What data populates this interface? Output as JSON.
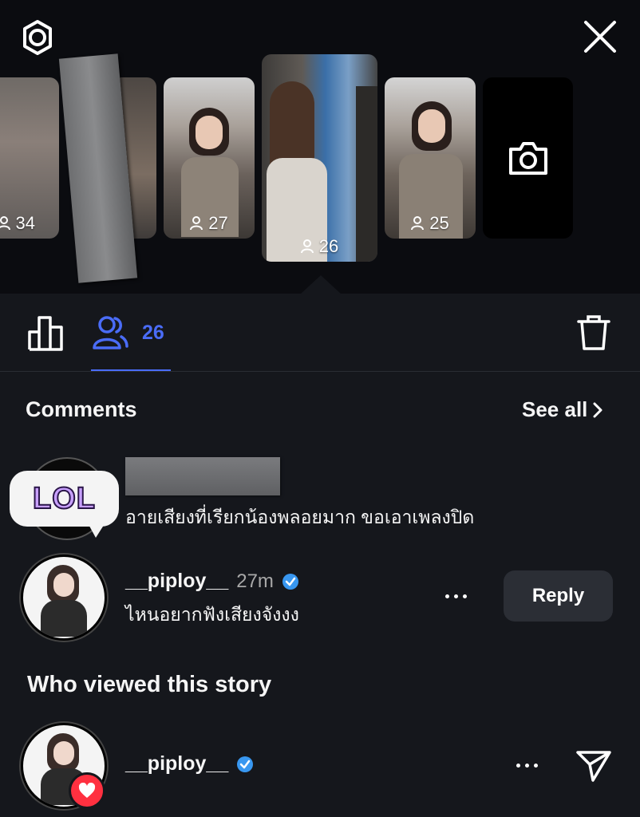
{
  "header": {
    "settings_icon": "gear-icon",
    "close_icon": "close-icon"
  },
  "stories": [
    {
      "viewers": "34"
    },
    {
      "viewers": "27"
    },
    {
      "viewers": "26",
      "selected": true
    },
    {
      "viewers": "25"
    }
  ],
  "camera_icon": "camera-icon",
  "tabs": {
    "insights_icon": "bar-chart-icon",
    "viewers_icon": "people-icon",
    "viewers_count": "26",
    "delete_icon": "trash-icon"
  },
  "comments": {
    "heading": "Comments",
    "see_all": "See all",
    "items": [
      {
        "sticker": "LOL",
        "text": "อายเสียงที่เรียกน้องพลอยมาก ขอเอาเพลงปิด"
      },
      {
        "username": "__piploy__",
        "time": "27m",
        "text": "ไหนอยากฟังเสียงจังงง",
        "reply_label": "Reply"
      }
    ]
  },
  "viewers": {
    "heading": "Who viewed this story",
    "items": [
      {
        "username": "__piploy__"
      }
    ]
  },
  "colors": {
    "accent": "#4a6cf7",
    "verified": "#3897f0",
    "like": "#ff3040"
  }
}
